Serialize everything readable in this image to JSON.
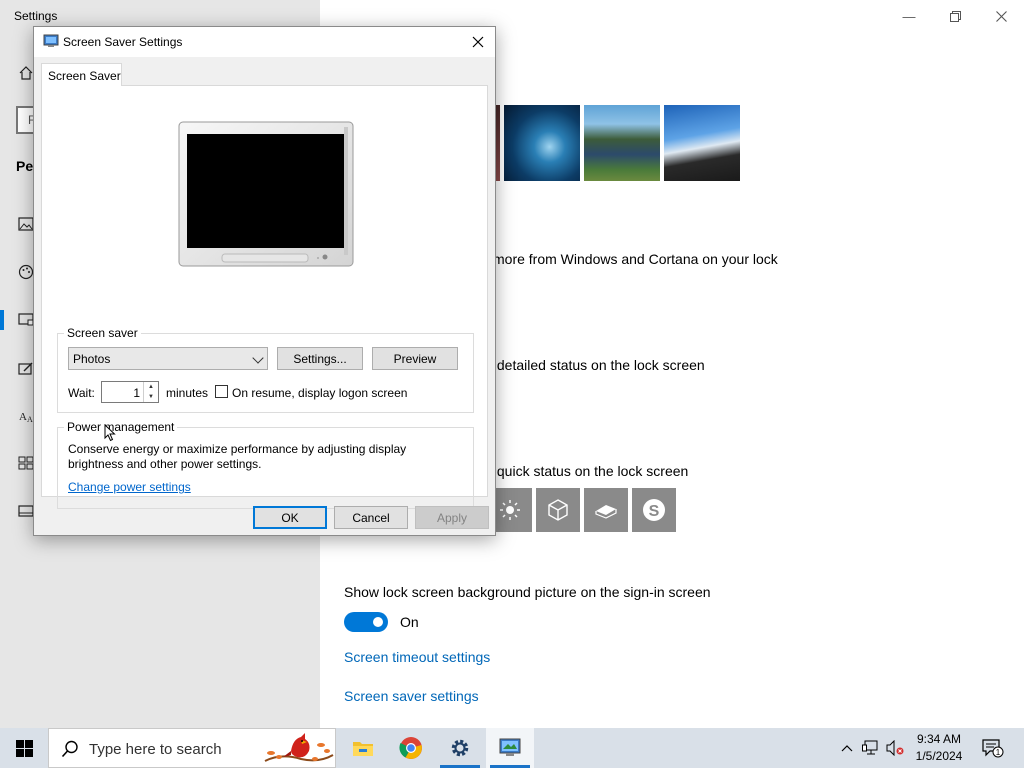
{
  "settings": {
    "title": "Settings",
    "search_placeholder_fragment": "F",
    "section_fragment": "Per",
    "text_cortana": "more from Windows and Cortana on your lock",
    "text_detailed": "v detailed status on the lock screen",
    "text_quick": "v quick status on the lock screen",
    "show_background_label": "Show lock screen background picture on the sign-in screen",
    "toggle_state": "On",
    "link_timeout": "Screen timeout settings",
    "link_saver": "Screen saver settings"
  },
  "dialog": {
    "title": "Screen Saver Settings",
    "tab": "Screen Saver",
    "screensaver_group": "Screen saver",
    "screensaver_selected": "Photos",
    "settings_button": "Settings...",
    "preview_button": "Preview",
    "wait_label": "Wait:",
    "wait_value": "1",
    "minutes_label": "minutes",
    "resume_label": "On resume, display logon screen",
    "resume_checked": false,
    "power_group": "Power management",
    "power_text_1": "Conserve energy or maximize performance by adjusting display",
    "power_text_2": "brightness and other power settings.",
    "power_link": "Change power settings",
    "ok": "OK",
    "cancel": "Cancel",
    "apply": "Apply"
  },
  "taskbar": {
    "search_placeholder": "Type here to search",
    "time": "9:34 AM",
    "date": "1/5/2024",
    "notification_count": "1"
  },
  "colors": {
    "accent": "#0078d7",
    "link": "#0067b8",
    "sidebar": "#e6e6e6"
  }
}
